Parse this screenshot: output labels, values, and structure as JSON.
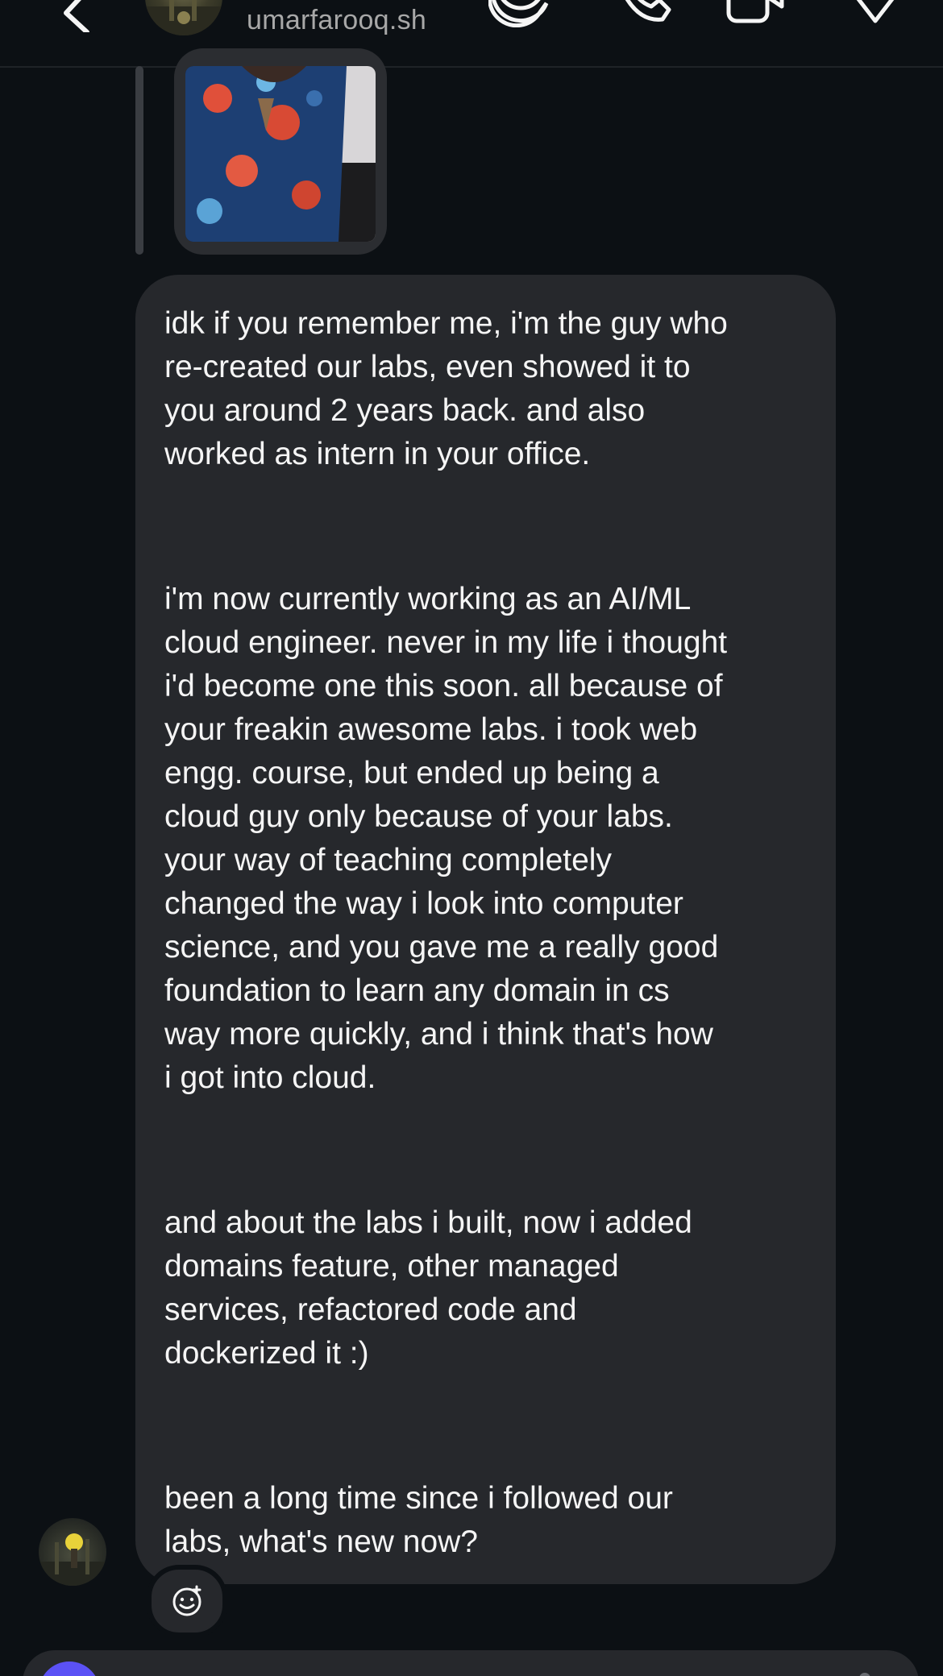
{
  "header": {
    "username": "umarfarooq.sh",
    "icons": {
      "back": "chevron-left-icon",
      "avatar": "avatar",
      "sticker": "sticker-icon",
      "call": "phone-icon",
      "video": "video-camera-icon",
      "tag": "tag-icon"
    }
  },
  "thread": {
    "reply_media": "photo",
    "message": {
      "paragraphs": [
        "idk if you remember me, i'm the guy who\nre-created our labs, even showed it to\nyou around 2 years back. and also\nworked as intern in your office.",
        "i'm now currently working as an AI/ML\ncloud engineer. never in my life i thought\ni'd become one this soon. all because of\nyour freakin awesome labs. i took web\nengg. course, but ended up being a\ncloud guy only because of your labs.\nyour way of teaching completely\nchanged the way i look into computer\nscience, and you gave me a really good\nfoundation to learn any domain in cs\nway more quickly, and i think that's how\ni got into cloud.",
        "and about the labs i built, now i added\ndomains feature, other managed\nservices, refactored code and\ndockerized it :)",
        "been a long time since i followed our\nlabs, what's new now?"
      ]
    },
    "react_icon": "add-reaction-icon"
  },
  "colors": {
    "background": "#0c1014",
    "bubble": "#26282c",
    "text": "#f5f5f5",
    "muted_text": "#a8a8a8",
    "accent": "#5b51f5"
  }
}
